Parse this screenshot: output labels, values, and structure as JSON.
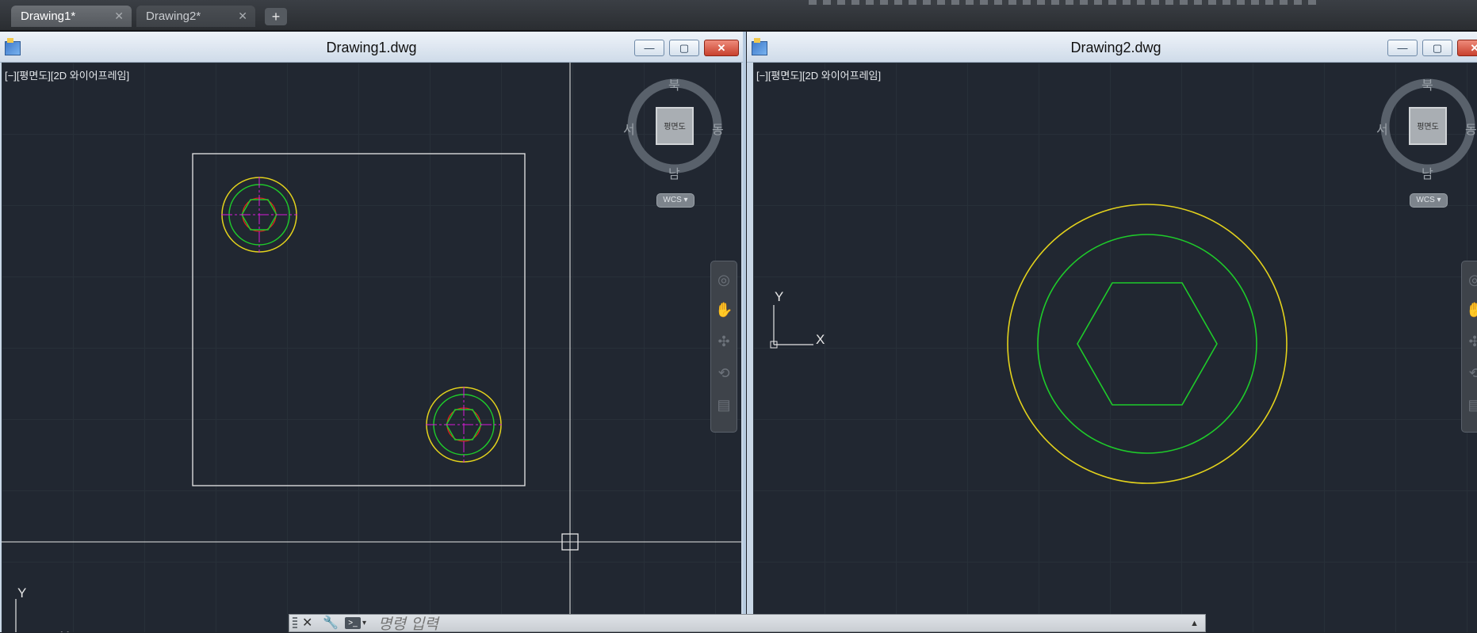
{
  "tabs": [
    {
      "label": "Drawing1*",
      "active": true
    },
    {
      "label": "Drawing2*",
      "active": false
    }
  ],
  "tab_close_glyph": "✕",
  "add_tab_glyph": "+",
  "windows": [
    {
      "title": "Drawing1.dwg",
      "viewport_label": "[−][평면도][2D 와이어프레임]",
      "viewcube": {
        "north": "북",
        "south": "남",
        "west": "서",
        "east": "동",
        "face": "평면도",
        "wcs": "WCS ▾"
      },
      "ucs": {
        "x": "X",
        "y": "Y"
      }
    },
    {
      "title": "Drawing2.dwg",
      "viewport_label": "[−][평면도][2D 와이어프레임]",
      "viewcube": {
        "north": "북",
        "south": "남",
        "west": "서",
        "east": "동",
        "face": "평면도",
        "wcs": "WCS ▾"
      },
      "ucs": {
        "x": "X",
        "y": "Y"
      }
    }
  ],
  "window_buttons": {
    "minimize": "—",
    "maximize": "▢",
    "close": "✕"
  },
  "commandline": {
    "placeholder": "명령 입력",
    "prompt_icon": ">_",
    "dropdown": "▾",
    "expand": "▲"
  },
  "colors": {
    "canvas_bg": "#212731",
    "yellow": "#e3d21c",
    "green": "#1ecb2a",
    "red": "#e0241b",
    "magenta": "#d81ad8",
    "white_line": "#e8e8e8"
  }
}
